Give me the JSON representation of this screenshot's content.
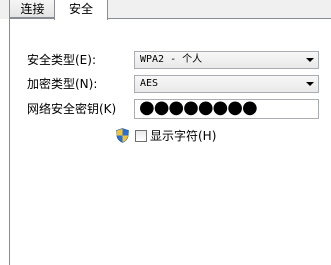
{
  "tabs": [
    {
      "label": "连接"
    },
    {
      "label": "安全"
    }
  ],
  "form": {
    "security_type_label": "安全类型(E):",
    "security_type_value": "WPA2 - 个人",
    "encryption_type_label": "加密类型(N):",
    "encryption_type_value": "AES",
    "network_key_label": "网络安全密钥(K)",
    "network_key_masked": "●●●●●●●●",
    "show_chars_label": "显示字符(H)",
    "show_chars_checked": false
  },
  "icons": {
    "uac_shield": "uac-shield-icon",
    "dropdown_arrow": "chevron-down-icon"
  },
  "colors": {
    "border": "#898c95",
    "field_border": "#abadb3",
    "shield_blue": "#2a6fd6",
    "shield_yellow": "#f4c430"
  }
}
